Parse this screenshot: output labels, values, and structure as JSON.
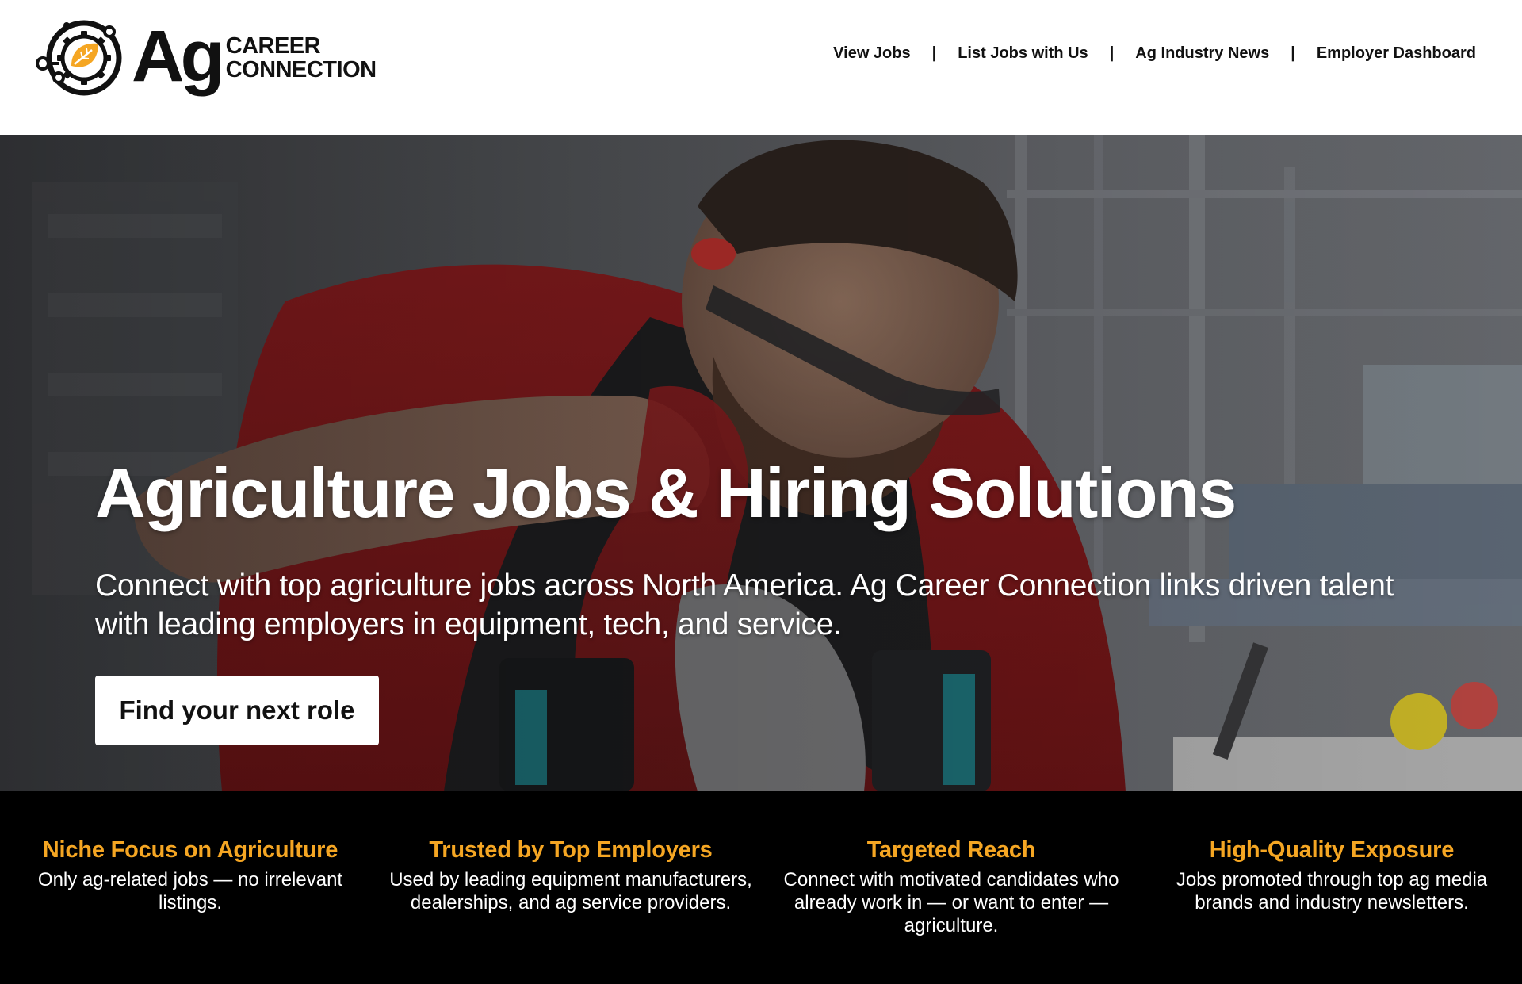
{
  "header": {
    "logo_ag": "Ag",
    "logo_line1": "CAREER",
    "logo_line2": "CONNECTION",
    "nav": [
      {
        "label": "View Jobs"
      },
      {
        "label": "List Jobs with Us"
      },
      {
        "label": "Ag Industry News"
      },
      {
        "label": "Employer Dashboard"
      }
    ],
    "separator": "|"
  },
  "hero": {
    "title": "Agriculture Jobs & Hiring Solutions",
    "subtitle": "Connect with top agriculture jobs across North America. Ag Career Connection links driven talent with leading employers in equipment, tech, and service.",
    "cta_label": "Find your next role"
  },
  "features": [
    {
      "title": "Niche Focus on Agriculture",
      "text": "Only ag-related jobs — no irrelevant listings."
    },
    {
      "title": "Trusted by Top Employers",
      "text": "Used by leading equipment manufacturers, dealerships, and ag service providers."
    },
    {
      "title": "Targeted Reach",
      "text": "Connect with motivated candidates who already work in — or want to enter — agriculture."
    },
    {
      "title": "High-Quality Exposure",
      "text": "Jobs promoted through top ag media brands and industry newsletters."
    }
  ],
  "colors": {
    "accent": "#f5a623",
    "features_bg": "#000000",
    "text_dark": "#111111"
  },
  "icons": {
    "logo_mark": "gear-leaf-circuit-icon",
    "hero_image": "worker-with-power-drills-photo"
  }
}
